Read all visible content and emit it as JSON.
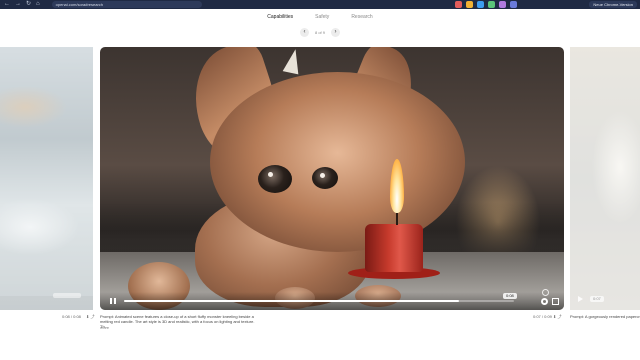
{
  "browser": {
    "nav_back": "←",
    "nav_forward": "→",
    "nav_reload": "↻",
    "nav_home": "⌂",
    "url": "openai.com/sora#research",
    "update_label": "Neue Chrome-Version",
    "extension_colors": [
      "#e35d5b",
      "#f2b134",
      "#3d9cf0",
      "#5bc47a",
      "#b07be0",
      "#6a7bdb"
    ]
  },
  "tabs": [
    {
      "label": "Capabilities",
      "active": true
    },
    {
      "label": "Safety",
      "active": false
    },
    {
      "label": "Research",
      "active": false
    }
  ],
  "pager": {
    "prev": "‹",
    "next": "›",
    "count": "8 of 9"
  },
  "video": {
    "time": "0:08",
    "progress_fraction": 0.86
  },
  "right_card": {
    "time": "0:07"
  },
  "captions": {
    "left_meta": "0:08 / 0:08",
    "left_meta_icons": "⬇ ⤴",
    "prompt": "Prompt: Animated scene features a close-up of a short fluffy monster kneeling beside a melting red candle. The art style is 3D and realistic, with a focus on lighting and texture. Th...",
    "more": "more",
    "right_meta": "0:07 / 0:09",
    "right_meta_icons": "⬇ ⤴",
    "right_prompt": "Prompt: A gorgeously rendered papercraft sea creatures."
  }
}
